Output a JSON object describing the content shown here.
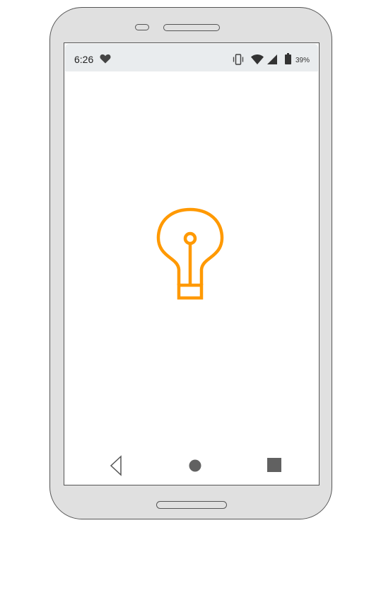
{
  "status_bar": {
    "time": "6:26",
    "battery_percent": "39%",
    "icons": [
      "heart-icon",
      "vibrate-icon",
      "wifi-icon",
      "signal-icon",
      "battery-icon"
    ]
  },
  "content": {
    "icon": "lightbulb-icon",
    "icon_color": "#FF9900"
  },
  "navigation_bar": {
    "buttons": [
      "back-button",
      "home-button",
      "recents-button"
    ]
  },
  "colors": {
    "device_body": "#E0E0E0",
    "status_bar_bg": "#E9ECEE",
    "nav_buttons": "#616161"
  }
}
